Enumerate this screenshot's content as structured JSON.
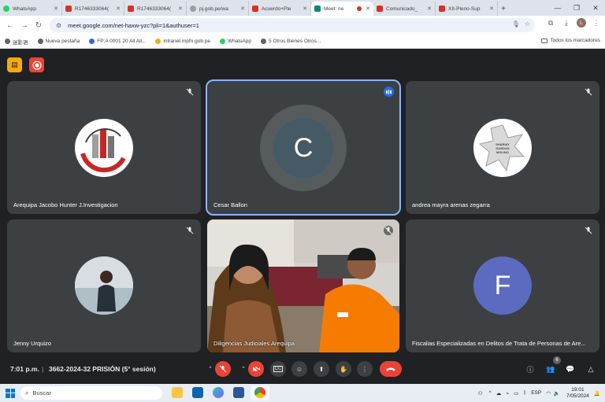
{
  "browser": {
    "tabs": [
      {
        "label": "WhatsApp",
        "color": "#25d366"
      },
      {
        "label": "R1746333064(",
        "color": "#d93025"
      },
      {
        "label": "R1746333064(",
        "color": "#d93025"
      },
      {
        "label": "pj.gob.pe/wa",
        "color": "#9aa0a6"
      },
      {
        "label": "Acuerdo+Ple",
        "color": "#d93025"
      },
      {
        "label": "Meet: ne",
        "color": "#00897b"
      },
      {
        "label": "Comunicado_",
        "color": "#d93025"
      },
      {
        "label": "XII-Pleno-Sup",
        "color": "#d93025"
      }
    ],
    "url": "meet.google.com/net-haxw-yzc?pli=1&authuser=1",
    "bookmarks": [
      "迷影语",
      "Nueva pestaña",
      "FP:A 0001 20 All All...",
      "intranet.mpfn.gob.pe",
      "WhatsApp",
      "5 Otros Bienes Otros..."
    ],
    "bookmarks_all": "Todos los marcadores",
    "profile_initial": "L"
  },
  "meet": {
    "participants": [
      {
        "name": "Arequipa Jacobo Hunter J.Investigacion"
      },
      {
        "name": "Cesar Ballon",
        "initial": "C"
      },
      {
        "name": "andrea mayra arenas zegarra",
        "badge_lines": [
          "SHARIAY",
          "GUNDAS",
          "MOLINO"
        ]
      },
      {
        "name": "Jenny Urquizo"
      },
      {
        "name": "Diligencias Judiciales Arequipa"
      },
      {
        "name": "Fiscalias Especializadas en Delitos de Trata de Personas de Are...",
        "initial": "F"
      }
    ],
    "time": "7:01 p.m.",
    "meeting_title": "3662-2024-32 PRISIÓN (5° sesión)",
    "people_count": "6"
  },
  "taskbar": {
    "search_placeholder": "Buscar",
    "lang": "ESP",
    "clock_time": "19:01",
    "clock_date": "7/05/2024"
  }
}
